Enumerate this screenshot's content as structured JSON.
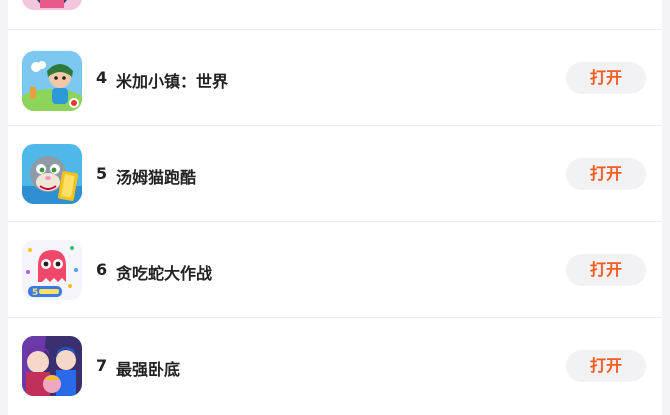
{
  "colors": {
    "accent": "#ff5a1f",
    "button_bg": "#f2f2f5",
    "page_bg": "#f4f4f6",
    "text": "#222222"
  },
  "list": {
    "items": [
      {
        "rank": "4",
        "name": "米加小镇：世界",
        "button": "打开",
        "icon": "toca-world-app-icon"
      },
      {
        "rank": "5",
        "name": "汤姆猫跑酷",
        "button": "打开",
        "icon": "tom-gold-run-app-icon"
      },
      {
        "rank": "6",
        "name": "贪吃蛇大作战",
        "button": "打开",
        "icon": "snake-battle-app-icon"
      },
      {
        "rank": "7",
        "name": "最强卧底",
        "button": "打开",
        "icon": "undercover-app-icon"
      }
    ]
  }
}
